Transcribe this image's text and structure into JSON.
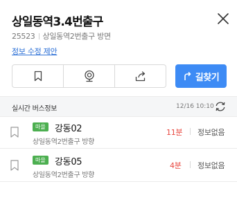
{
  "station": {
    "name": "상일동역3.4번출구",
    "id": "25523",
    "direction": "상일동역2번출구 방면",
    "edit_link": "정보 수정 제안"
  },
  "actions": {
    "route_label": "길찾기",
    "icons": [
      "bookmark-icon",
      "cctv-icon",
      "share-icon",
      "route-direction-icon"
    ]
  },
  "realtime": {
    "title": "실시간 버스정보",
    "updated": "12/16 10:10"
  },
  "buses": [
    {
      "badge": "마을",
      "name": "강동02",
      "direction": "상일동역2번출구 방향",
      "arrival": "11분",
      "info": "정보없음"
    },
    {
      "badge": "마을",
      "name": "강동05",
      "direction": "상일동역2번출구 방향",
      "arrival": "4분",
      "info": "정보없음"
    }
  ],
  "colors": {
    "accent": "#3d8bf5",
    "badge": "#4caf50",
    "arrival": "#e8473f",
    "link": "#2b6fd6"
  }
}
